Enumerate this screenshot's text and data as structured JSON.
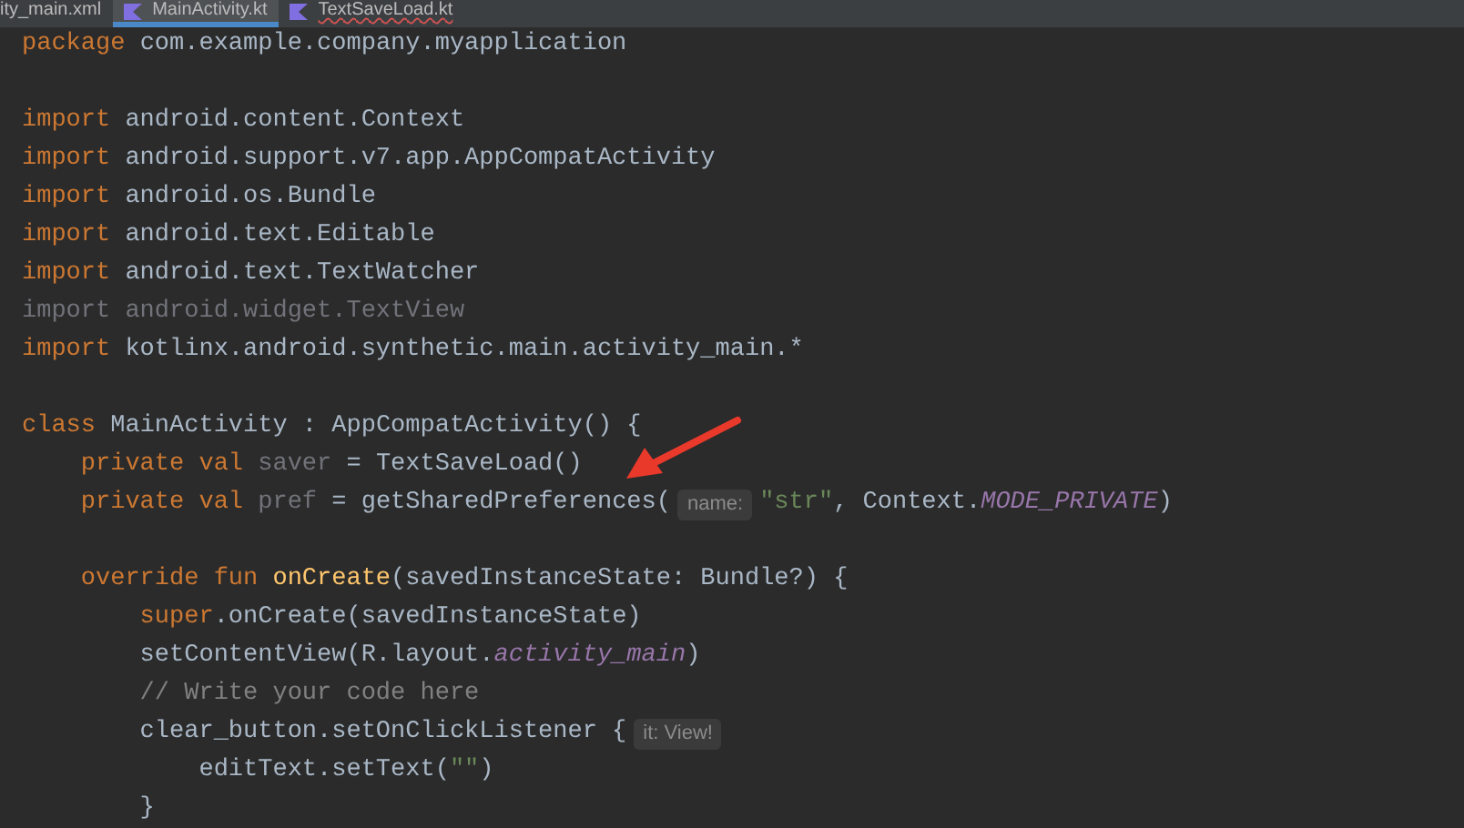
{
  "tabs": [
    {
      "label": "ity_main.xml",
      "selected": false,
      "error": false
    },
    {
      "label": "MainActivity.kt",
      "selected": true,
      "error": false
    },
    {
      "label": "TextSaveLoad.kt",
      "selected": false,
      "error": true
    }
  ],
  "code_lines": [
    {
      "kind": "code",
      "segments": [
        {
          "kind": "code",
          "tokens": [
            {
              "kind": "keyword",
              "text": "package"
            },
            {
              "kind": "plain",
              "text": " com.example.company.myapplication"
            }
          ]
        }
      ]
    },
    {
      "kind": "blank"
    },
    {
      "kind": "code",
      "segments": [
        {
          "kind": "code",
          "tokens": [
            {
              "kind": "keyword",
              "text": "import"
            },
            {
              "kind": "plain",
              "text": " android.content.Context"
            }
          ]
        }
      ]
    },
    {
      "kind": "code",
      "segments": [
        {
          "kind": "code",
          "tokens": [
            {
              "kind": "keyword",
              "text": "import"
            },
            {
              "kind": "plain",
              "text": " android.support.v7.app.AppCompatActivity"
            }
          ]
        }
      ]
    },
    {
      "kind": "code",
      "segments": [
        {
          "kind": "code",
          "tokens": [
            {
              "kind": "keyword",
              "text": "import"
            },
            {
              "kind": "plain",
              "text": " android.os.Bundle"
            }
          ]
        }
      ]
    },
    {
      "kind": "code",
      "segments": [
        {
          "kind": "code",
          "tokens": [
            {
              "kind": "keyword",
              "text": "import"
            },
            {
              "kind": "plain",
              "text": " android.text.Editable"
            }
          ]
        }
      ]
    },
    {
      "kind": "code",
      "segments": [
        {
          "kind": "code",
          "tokens": [
            {
              "kind": "keyword",
              "text": "import"
            },
            {
              "kind": "plain",
              "text": " android.text.TextWatcher"
            }
          ]
        }
      ]
    },
    {
      "kind": "code",
      "segments": [
        {
          "kind": "code",
          "tokens": [
            {
              "kind": "unused",
              "text": "import android.widget.TextView"
            }
          ]
        }
      ]
    },
    {
      "kind": "code",
      "segments": [
        {
          "kind": "code",
          "tokens": [
            {
              "kind": "keyword",
              "text": "import"
            },
            {
              "kind": "plain",
              "text": " kotlinx.android.synthetic.main.activity_main.*"
            }
          ]
        }
      ]
    },
    {
      "kind": "blank"
    },
    {
      "kind": "code",
      "segments": [
        {
          "kind": "code",
          "tokens": [
            {
              "kind": "keyword",
              "text": "class"
            },
            {
              "kind": "plain",
              "text": " MainActivity : AppCompatActivity() {"
            }
          ]
        }
      ]
    },
    {
      "kind": "code",
      "segments": [
        {
          "kind": "code",
          "tokens": [
            {
              "kind": "keyword",
              "text": "    private val"
            },
            {
              "kind": "unused",
              "text": " saver"
            },
            {
              "kind": "plain",
              "text": " = TextSaveLoad()"
            }
          ]
        }
      ]
    },
    {
      "kind": "code",
      "segments": [
        {
          "kind": "code",
          "tokens": [
            {
              "kind": "keyword",
              "text": "    private val"
            },
            {
              "kind": "unused",
              "text": " pref"
            },
            {
              "kind": "plain",
              "text": " = getSharedPreferences("
            }
          ]
        },
        {
          "kind": "hint",
          "text": "name:"
        },
        {
          "kind": "code",
          "tokens": [
            {
              "kind": "string",
              "text": "\"str\""
            },
            {
              "kind": "plain",
              "text": ", Context."
            },
            {
              "kind": "constant",
              "text": "MODE_PRIVATE"
            },
            {
              "kind": "plain",
              "text": ")"
            }
          ]
        }
      ]
    },
    {
      "kind": "blank"
    },
    {
      "kind": "code",
      "segments": [
        {
          "kind": "code",
          "tokens": [
            {
              "kind": "keyword",
              "text": "    override fun"
            },
            {
              "kind": "function",
              "text": " onCreate"
            },
            {
              "kind": "plain",
              "text": "(savedInstanceState: Bundle?) {"
            }
          ]
        }
      ]
    },
    {
      "kind": "code",
      "segments": [
        {
          "kind": "code",
          "tokens": [
            {
              "kind": "keyword",
              "text": "        super"
            },
            {
              "kind": "plain",
              "text": ".onCreate(savedInstanceState)"
            }
          ]
        }
      ]
    },
    {
      "kind": "code",
      "segments": [
        {
          "kind": "code",
          "tokens": [
            {
              "kind": "plain",
              "text": "        setContentView(R.layout."
            },
            {
              "kind": "constant",
              "text": "activity_main"
            },
            {
              "kind": "plain",
              "text": ")"
            }
          ]
        }
      ]
    },
    {
      "kind": "code",
      "segments": [
        {
          "kind": "code",
          "tokens": [
            {
              "kind": "comment",
              "text": "        // Write your code here"
            }
          ]
        }
      ]
    },
    {
      "kind": "code",
      "segments": [
        {
          "kind": "code",
          "tokens": [
            {
              "kind": "plain",
              "text": "        clear_button.setOnClickListener {"
            }
          ]
        },
        {
          "kind": "hint",
          "text": "it: View!"
        }
      ]
    },
    {
      "kind": "code",
      "segments": [
        {
          "kind": "code",
          "tokens": [
            {
              "kind": "plain",
              "text": "            editText.setText("
            },
            {
              "kind": "string",
              "text": "\"\""
            },
            {
              "kind": "plain",
              "text": ")"
            }
          ]
        }
      ]
    },
    {
      "kind": "code",
      "segments": [
        {
          "kind": "code",
          "tokens": [
            {
              "kind": "plain",
              "text": "        }"
            }
          ]
        }
      ]
    }
  ]
}
